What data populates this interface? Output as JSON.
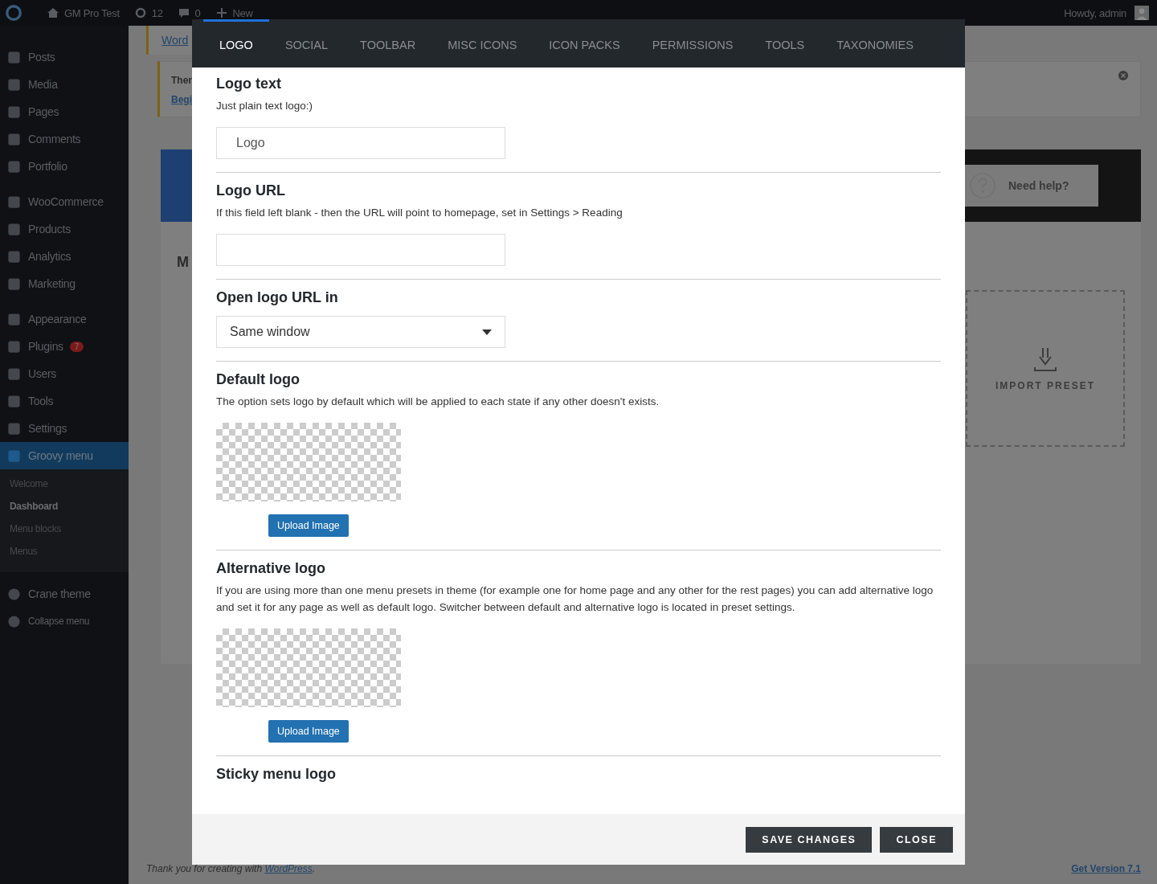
{
  "admin_bar": {
    "site": "GM Pro Test",
    "updates": "12",
    "comments": "0",
    "new": "New",
    "greeting": "Howdy, admin"
  },
  "sidebar": {
    "groups": [
      [
        {
          "label": "Posts",
          "selected": false
        },
        {
          "label": "Media",
          "selected": false
        },
        {
          "label": "Pages",
          "selected": false
        },
        {
          "label": "Comments",
          "selected": false
        },
        {
          "label": "Portfolio",
          "selected": false
        }
      ],
      [
        {
          "label": "WooCommerce",
          "selected": false
        },
        {
          "label": "Products",
          "selected": false
        },
        {
          "label": "Analytics",
          "selected": false
        },
        {
          "label": "Marketing",
          "selected": false
        }
      ],
      [
        {
          "label": "Appearance",
          "selected": false
        },
        {
          "label": "Plugins",
          "selected": false,
          "badge": "7"
        },
        {
          "label": "Users",
          "selected": false
        },
        {
          "label": "Tools",
          "selected": false
        },
        {
          "label": "Settings",
          "selected": false
        },
        {
          "label": "Groovy menu",
          "selected": true
        }
      ]
    ],
    "submenu": [
      {
        "label": "Welcome",
        "selected": false
      },
      {
        "label": "Dashboard",
        "selected": true
      },
      {
        "label": "Menu blocks",
        "selected": false
      },
      {
        "label": "Menus",
        "selected": false
      }
    ],
    "footer_items": [
      {
        "label": "Crane theme"
      },
      {
        "label": "Collapse menu"
      }
    ]
  },
  "background": {
    "notice_link": "Word",
    "notice_text": "Ther",
    "notice_action": "Begi",
    "heading": "M",
    "help_button": "Need help?",
    "import_label": "IMPORT PRESET",
    "footer_text": "Thank you for creating with ",
    "footer_link": "WordPress",
    "footer_end": ".",
    "version_link": "Get Version 7.1"
  },
  "modal": {
    "tabs": [
      {
        "label": "LOGO",
        "selected": true
      },
      {
        "label": "SOCIAL",
        "selected": false
      },
      {
        "label": "TOOLBAR",
        "selected": false
      },
      {
        "label": "MISC ICONS",
        "selected": false
      },
      {
        "label": "ICON PACKS",
        "selected": false
      },
      {
        "label": "PERMISSIONS",
        "selected": false
      },
      {
        "label": "TOOLS",
        "selected": false
      },
      {
        "label": "TAXONOMIES",
        "selected": false
      }
    ],
    "sections": [
      {
        "kind": "text",
        "title": "Logo text",
        "description": "Just plain text logo:)",
        "value": "Logo"
      },
      {
        "kind": "text",
        "title": "Logo URL",
        "description": "If this field left blank - then the URL will point to homepage, set in Settings > Reading"
      },
      {
        "kind": "select",
        "title": "Open logo URL in",
        "value": "Same window"
      },
      {
        "kind": "image",
        "title": "Default logo",
        "description": "The option sets logo by default which will be applied to each state if any other doesn't exists.",
        "button": "Upload Image"
      },
      {
        "kind": "image",
        "title": "Alternative logo",
        "description": "If you are using more than one menu presets in theme (for example one for home page and any other for the rest pages) you can add alternative logo and set it for any page as well as default logo. Switcher between default and alternative logo is located in preset settings.",
        "button": "Upload Image"
      },
      {
        "kind": "heading",
        "title": "Sticky menu logo"
      }
    ],
    "buttons": [
      "SAVE CHANGES",
      "CLOSE"
    ]
  }
}
